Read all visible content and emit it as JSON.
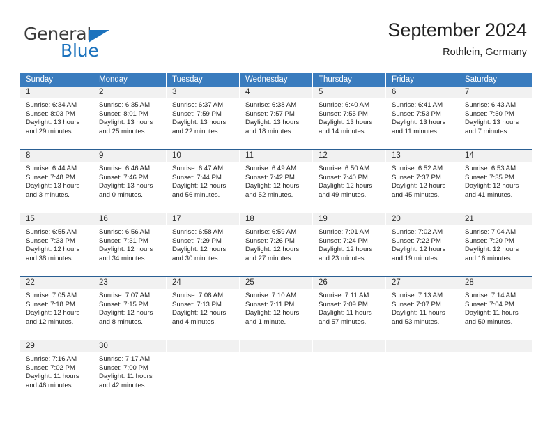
{
  "logo": {
    "word_top": "General",
    "word_bottom": "Blue",
    "triangle_color": "#1b72bd",
    "text_color": "#3b3b3b"
  },
  "header": {
    "title": "September 2024",
    "location": "Rothlein, Germany"
  },
  "theme": {
    "header_blue": "#3a7cbe",
    "rule_blue": "#2a5f93",
    "daynum_bg": "#f1f1f1"
  },
  "weekdays": [
    "Sunday",
    "Monday",
    "Tuesday",
    "Wednesday",
    "Thursday",
    "Friday",
    "Saturday"
  ],
  "weeks": [
    [
      {
        "day": "1",
        "sunrise": "Sunrise: 6:34 AM",
        "sunset": "Sunset: 8:03 PM",
        "daylight1": "Daylight: 13 hours",
        "daylight2": "and 29 minutes."
      },
      {
        "day": "2",
        "sunrise": "Sunrise: 6:35 AM",
        "sunset": "Sunset: 8:01 PM",
        "daylight1": "Daylight: 13 hours",
        "daylight2": "and 25 minutes."
      },
      {
        "day": "3",
        "sunrise": "Sunrise: 6:37 AM",
        "sunset": "Sunset: 7:59 PM",
        "daylight1": "Daylight: 13 hours",
        "daylight2": "and 22 minutes."
      },
      {
        "day": "4",
        "sunrise": "Sunrise: 6:38 AM",
        "sunset": "Sunset: 7:57 PM",
        "daylight1": "Daylight: 13 hours",
        "daylight2": "and 18 minutes."
      },
      {
        "day": "5",
        "sunrise": "Sunrise: 6:40 AM",
        "sunset": "Sunset: 7:55 PM",
        "daylight1": "Daylight: 13 hours",
        "daylight2": "and 14 minutes."
      },
      {
        "day": "6",
        "sunrise": "Sunrise: 6:41 AM",
        "sunset": "Sunset: 7:53 PM",
        "daylight1": "Daylight: 13 hours",
        "daylight2": "and 11 minutes."
      },
      {
        "day": "7",
        "sunrise": "Sunrise: 6:43 AM",
        "sunset": "Sunset: 7:50 PM",
        "daylight1": "Daylight: 13 hours",
        "daylight2": "and 7 minutes."
      }
    ],
    [
      {
        "day": "8",
        "sunrise": "Sunrise: 6:44 AM",
        "sunset": "Sunset: 7:48 PM",
        "daylight1": "Daylight: 13 hours",
        "daylight2": "and 3 minutes."
      },
      {
        "day": "9",
        "sunrise": "Sunrise: 6:46 AM",
        "sunset": "Sunset: 7:46 PM",
        "daylight1": "Daylight: 13 hours",
        "daylight2": "and 0 minutes."
      },
      {
        "day": "10",
        "sunrise": "Sunrise: 6:47 AM",
        "sunset": "Sunset: 7:44 PM",
        "daylight1": "Daylight: 12 hours",
        "daylight2": "and 56 minutes."
      },
      {
        "day": "11",
        "sunrise": "Sunrise: 6:49 AM",
        "sunset": "Sunset: 7:42 PM",
        "daylight1": "Daylight: 12 hours",
        "daylight2": "and 52 minutes."
      },
      {
        "day": "12",
        "sunrise": "Sunrise: 6:50 AM",
        "sunset": "Sunset: 7:40 PM",
        "daylight1": "Daylight: 12 hours",
        "daylight2": "and 49 minutes."
      },
      {
        "day": "13",
        "sunrise": "Sunrise: 6:52 AM",
        "sunset": "Sunset: 7:37 PM",
        "daylight1": "Daylight: 12 hours",
        "daylight2": "and 45 minutes."
      },
      {
        "day": "14",
        "sunrise": "Sunrise: 6:53 AM",
        "sunset": "Sunset: 7:35 PM",
        "daylight1": "Daylight: 12 hours",
        "daylight2": "and 41 minutes."
      }
    ],
    [
      {
        "day": "15",
        "sunrise": "Sunrise: 6:55 AM",
        "sunset": "Sunset: 7:33 PM",
        "daylight1": "Daylight: 12 hours",
        "daylight2": "and 38 minutes."
      },
      {
        "day": "16",
        "sunrise": "Sunrise: 6:56 AM",
        "sunset": "Sunset: 7:31 PM",
        "daylight1": "Daylight: 12 hours",
        "daylight2": "and 34 minutes."
      },
      {
        "day": "17",
        "sunrise": "Sunrise: 6:58 AM",
        "sunset": "Sunset: 7:29 PM",
        "daylight1": "Daylight: 12 hours",
        "daylight2": "and 30 minutes."
      },
      {
        "day": "18",
        "sunrise": "Sunrise: 6:59 AM",
        "sunset": "Sunset: 7:26 PM",
        "daylight1": "Daylight: 12 hours",
        "daylight2": "and 27 minutes."
      },
      {
        "day": "19",
        "sunrise": "Sunrise: 7:01 AM",
        "sunset": "Sunset: 7:24 PM",
        "daylight1": "Daylight: 12 hours",
        "daylight2": "and 23 minutes."
      },
      {
        "day": "20",
        "sunrise": "Sunrise: 7:02 AM",
        "sunset": "Sunset: 7:22 PM",
        "daylight1": "Daylight: 12 hours",
        "daylight2": "and 19 minutes."
      },
      {
        "day": "21",
        "sunrise": "Sunrise: 7:04 AM",
        "sunset": "Sunset: 7:20 PM",
        "daylight1": "Daylight: 12 hours",
        "daylight2": "and 16 minutes."
      }
    ],
    [
      {
        "day": "22",
        "sunrise": "Sunrise: 7:05 AM",
        "sunset": "Sunset: 7:18 PM",
        "daylight1": "Daylight: 12 hours",
        "daylight2": "and 12 minutes."
      },
      {
        "day": "23",
        "sunrise": "Sunrise: 7:07 AM",
        "sunset": "Sunset: 7:15 PM",
        "daylight1": "Daylight: 12 hours",
        "daylight2": "and 8 minutes."
      },
      {
        "day": "24",
        "sunrise": "Sunrise: 7:08 AM",
        "sunset": "Sunset: 7:13 PM",
        "daylight1": "Daylight: 12 hours",
        "daylight2": "and 4 minutes."
      },
      {
        "day": "25",
        "sunrise": "Sunrise: 7:10 AM",
        "sunset": "Sunset: 7:11 PM",
        "daylight1": "Daylight: 12 hours",
        "daylight2": "and 1 minute."
      },
      {
        "day": "26",
        "sunrise": "Sunrise: 7:11 AM",
        "sunset": "Sunset: 7:09 PM",
        "daylight1": "Daylight: 11 hours",
        "daylight2": "and 57 minutes."
      },
      {
        "day": "27",
        "sunrise": "Sunrise: 7:13 AM",
        "sunset": "Sunset: 7:07 PM",
        "daylight1": "Daylight: 11 hours",
        "daylight2": "and 53 minutes."
      },
      {
        "day": "28",
        "sunrise": "Sunrise: 7:14 AM",
        "sunset": "Sunset: 7:04 PM",
        "daylight1": "Daylight: 11 hours",
        "daylight2": "and 50 minutes."
      }
    ],
    [
      {
        "day": "29",
        "sunrise": "Sunrise: 7:16 AM",
        "sunset": "Sunset: 7:02 PM",
        "daylight1": "Daylight: 11 hours",
        "daylight2": "and 46 minutes."
      },
      {
        "day": "30",
        "sunrise": "Sunrise: 7:17 AM",
        "sunset": "Sunset: 7:00 PM",
        "daylight1": "Daylight: 11 hours",
        "daylight2": "and 42 minutes."
      },
      {
        "day": "",
        "sunrise": "",
        "sunset": "",
        "daylight1": "",
        "daylight2": ""
      },
      {
        "day": "",
        "sunrise": "",
        "sunset": "",
        "daylight1": "",
        "daylight2": ""
      },
      {
        "day": "",
        "sunrise": "",
        "sunset": "",
        "daylight1": "",
        "daylight2": ""
      },
      {
        "day": "",
        "sunrise": "",
        "sunset": "",
        "daylight1": "",
        "daylight2": ""
      },
      {
        "day": "",
        "sunrise": "",
        "sunset": "",
        "daylight1": "",
        "daylight2": ""
      }
    ]
  ]
}
